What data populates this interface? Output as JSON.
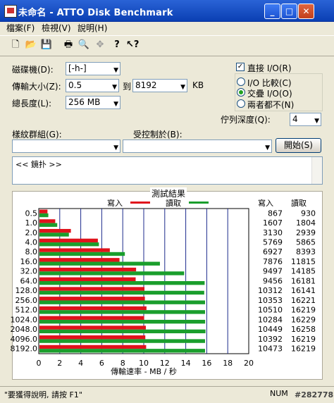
{
  "window": {
    "title": "未命名 - ATTO Disk Benchmark",
    "minimize": "_",
    "maximize": "□",
    "close": "✕"
  },
  "menu": [
    "檔案(F)",
    "檢視(V)",
    "說明(H)"
  ],
  "toolbar": {
    "new": "new-icon",
    "open": "open-icon",
    "save": "save-icon",
    "print": "print-icon",
    "preview": "print-preview-icon",
    "move": "move-icon",
    "help": "help-icon",
    "context_help": "context-help-icon"
  },
  "form": {
    "drive_label": "磁碟機(D):",
    "drive_value": "[-h-]",
    "transfer_label": "傳輸大小(Z):",
    "transfer_from": "0.5",
    "to_label": "到",
    "transfer_to": "8192",
    "unit": "KB",
    "length_label": "總長度(L):",
    "length_value": "256 MB",
    "direct_io": "直接 I/O(R)",
    "io_compare": "I/O 比較(C)",
    "overlapped_io": "交疊 I/O(O)",
    "neither": "兩者都不(N)",
    "queue_label": "佇列深度(Q):",
    "queue_value": "4",
    "pattern_label": "樣紋群組(G):",
    "controlled_label": "受控制於(B):",
    "start": "開始(S)",
    "description": "<< 鏡扑 >>"
  },
  "results_title": "測試結果",
  "legend": {
    "write": "寫入",
    "read": "讀取"
  },
  "columns": {
    "write": "寫入",
    "read": "讀取"
  },
  "colors": {
    "write": "#e0121b",
    "read": "#1a9e2c",
    "grid": "#1c2a8c"
  },
  "chart_data": {
    "type": "bar",
    "categories": [
      "0.5",
      "1.0",
      "2.0",
      "4.0",
      "8.0",
      "16.0",
      "32.0",
      "64.0",
      "128.0",
      "256.0",
      "512.0",
      "1024.0",
      "2048.0",
      "4096.0",
      "8192.0"
    ],
    "series": [
      {
        "name": "寫入",
        "values": [
          0.83,
          1.57,
          3.06,
          5.63,
          6.77,
          7.69,
          9.27,
          9.23,
          10.07,
          10.11,
          10.26,
          10.04,
          10.2,
          10.15,
          10.23
        ]
      },
      {
        "name": "讀取",
        "values": [
          0.91,
          1.76,
          2.87,
          5.73,
          8.2,
          11.54,
          13.85,
          15.8,
          15.76,
          15.84,
          15.84,
          15.85,
          15.88,
          15.84,
          15.84
        ]
      }
    ],
    "write_kb": [
      "867",
      "1607",
      "3130",
      "5769",
      "6927",
      "7876",
      "9497",
      "9456",
      "10312",
      "10353",
      "10510",
      "10284",
      "10449",
      "10392",
      "10473"
    ],
    "read_kb": [
      "930",
      "1804",
      "2939",
      "5865",
      "8393",
      "11815",
      "14185",
      "16181",
      "16141",
      "16221",
      "16219",
      "16229",
      "16258",
      "16219",
      "16219"
    ],
    "xlabel": "傳輸速率 - MB / 秒",
    "xticks": [
      "0",
      "2",
      "4",
      "6",
      "8",
      "10",
      "12",
      "14",
      "16",
      "18",
      "20"
    ],
    "xlim": [
      0,
      20
    ],
    "grid": true,
    "legend": "top"
  },
  "status": {
    "text": "\"要獲得說明, 請按 F1\"",
    "num": "NUM",
    "tag": "#282778"
  }
}
